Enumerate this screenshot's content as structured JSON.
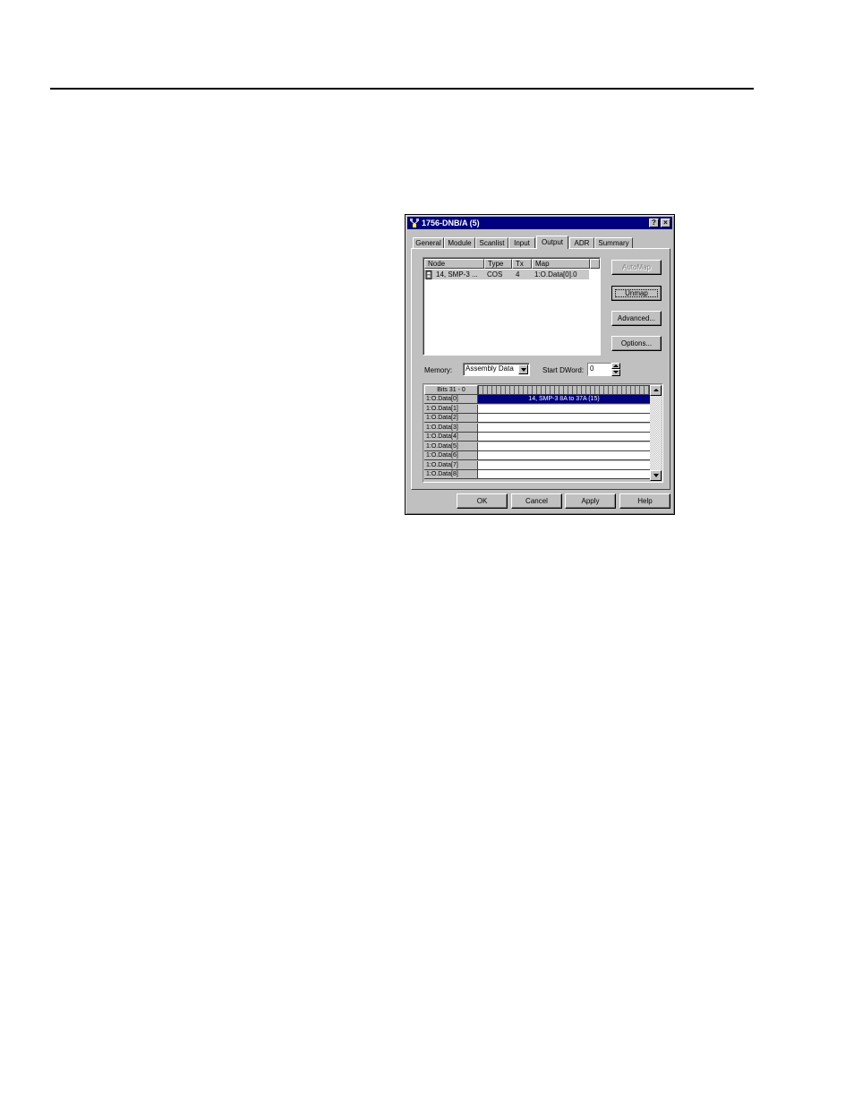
{
  "dialog": {
    "title": "1756-DNB/A (5)",
    "help_button": "?",
    "close_button": "×"
  },
  "tabs": [
    {
      "label": "General"
    },
    {
      "label": "Module"
    },
    {
      "label": "Scanlist"
    },
    {
      "label": "Input"
    },
    {
      "label": "Output",
      "active": true
    },
    {
      "label": "ADR"
    },
    {
      "label": "Summary"
    }
  ],
  "node_list": {
    "headers": {
      "node": "Node",
      "type": "Type",
      "tx": "Tx",
      "map": "Map"
    },
    "rows": [
      {
        "node": "14, SMP-3 ...",
        "type": "COS",
        "tx": "4",
        "map": "1:O.Data[0].0"
      }
    ]
  },
  "side_buttons": {
    "automap": "AutoMap",
    "unmap": "Unmap",
    "advanced": "Advanced...",
    "options": "Options..."
  },
  "memory": {
    "label": "Memory:",
    "value": "Assembly Data"
  },
  "start_dword": {
    "label": "Start DWord:",
    "value": "0"
  },
  "bit_grid": {
    "header": "Bits 31 - 0",
    "rows": [
      {
        "label": "1:O.Data[0]",
        "content": "14, SMP-3 8A to 37A (15)",
        "selected": true
      },
      {
        "label": "1:O.Data[1]",
        "content": ""
      },
      {
        "label": "1:O.Data[2]",
        "content": ""
      },
      {
        "label": "1:O.Data[3]",
        "content": ""
      },
      {
        "label": "1:O.Data[4]",
        "content": ""
      },
      {
        "label": "1:O.Data[5]",
        "content": ""
      },
      {
        "label": "1:O.Data[6]",
        "content": ""
      },
      {
        "label": "1:O.Data[7]",
        "content": ""
      },
      {
        "label": "1:O.Data[8]",
        "content": ""
      }
    ]
  },
  "footer_buttons": {
    "ok": "OK",
    "cancel": "Cancel",
    "apply": "Apply",
    "help": "Help"
  }
}
